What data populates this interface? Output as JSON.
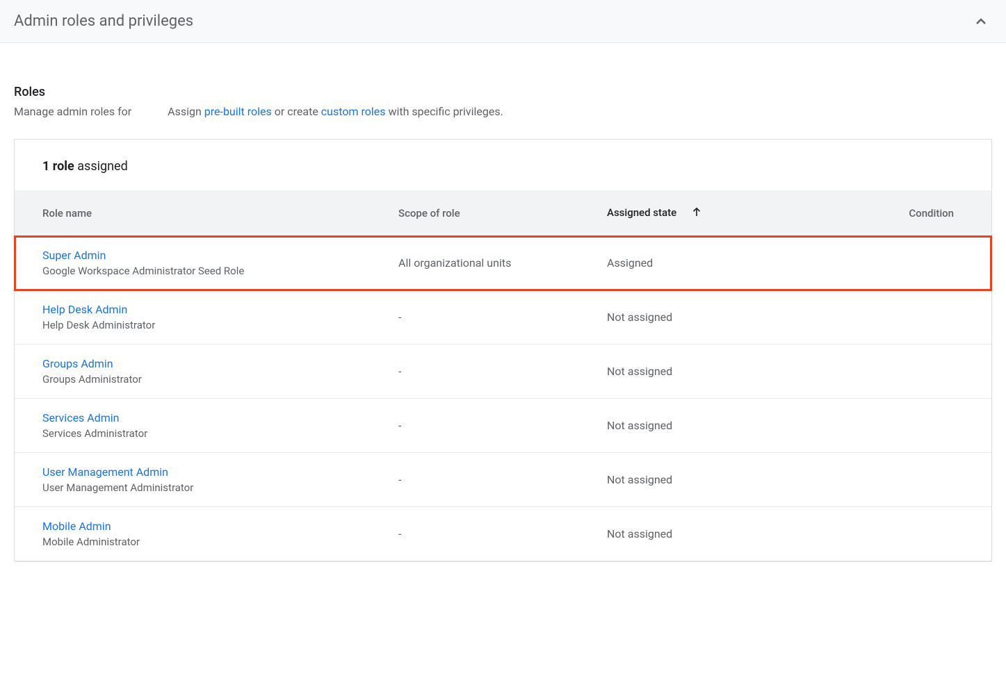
{
  "header": {
    "title": "Admin roles and privileges"
  },
  "section": {
    "title": "Roles",
    "subtitle_prefix": "Manage admin roles for",
    "subtitle_assign": "Assign ",
    "link_prebuilt": "pre-built roles",
    "subtitle_or": " or create ",
    "link_custom": "custom roles",
    "subtitle_suffix": " with specific privileges."
  },
  "card": {
    "count_bold": "1 role",
    "count_rest": " assigned"
  },
  "columns": {
    "role": "Role name",
    "scope": "Scope of role",
    "state": "Assigned state",
    "condition": "Condition"
  },
  "rows": [
    {
      "name": "Super Admin",
      "desc": "Google Workspace Administrator Seed Role",
      "scope": "All organizational units",
      "state": "Assigned",
      "condition": "",
      "highlighted": true
    },
    {
      "name": "Help Desk Admin",
      "desc": "Help Desk Administrator",
      "scope": "-",
      "state": "Not assigned",
      "condition": "",
      "highlighted": false
    },
    {
      "name": "Groups Admin",
      "desc": "Groups Administrator",
      "scope": "-",
      "state": "Not assigned",
      "condition": "",
      "highlighted": false
    },
    {
      "name": "Services Admin",
      "desc": "Services Administrator",
      "scope": "-",
      "state": "Not assigned",
      "condition": "",
      "highlighted": false
    },
    {
      "name": "User Management Admin",
      "desc": "User Management Administrator",
      "scope": "-",
      "state": "Not assigned",
      "condition": "",
      "highlighted": false
    },
    {
      "name": "Mobile Admin",
      "desc": "Mobile Administrator",
      "scope": "-",
      "state": "Not assigned",
      "condition": "",
      "highlighted": false
    }
  ]
}
